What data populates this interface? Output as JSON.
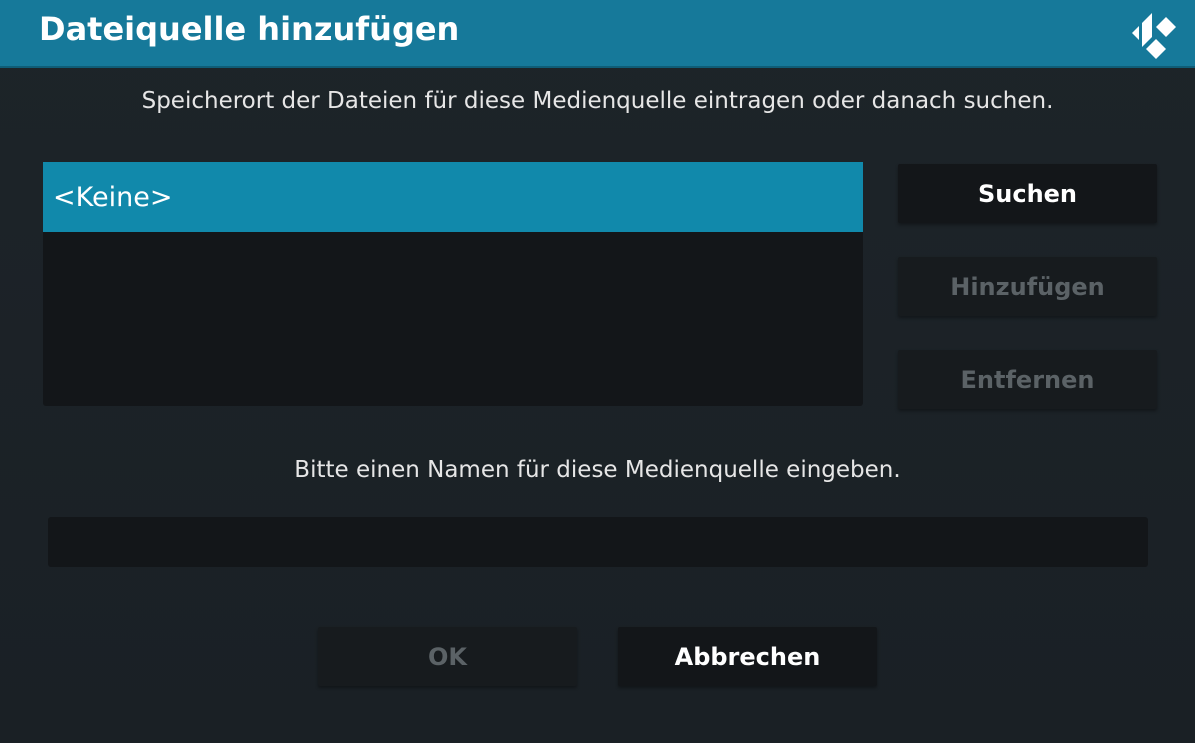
{
  "dialog": {
    "title": "Dateiquelle hinzufügen",
    "logo_icon": "kodi-logo-icon",
    "accent_color": "#1189ab",
    "header_color": "#16799a"
  },
  "path_section": {
    "prompt": "Speicherort der Dateien für diese Medienquelle eintragen oder danach suchen.",
    "items": [
      {
        "label": "<Keine>",
        "selected": true
      }
    ],
    "buttons": {
      "browse": "Suchen",
      "add": "Hinzufügen",
      "remove": "Entfernen"
    }
  },
  "name_section": {
    "prompt": "Bitte einen Namen für diese Medienquelle eingeben.",
    "value": ""
  },
  "footer": {
    "ok": "OK",
    "cancel": "Abbrechen"
  }
}
